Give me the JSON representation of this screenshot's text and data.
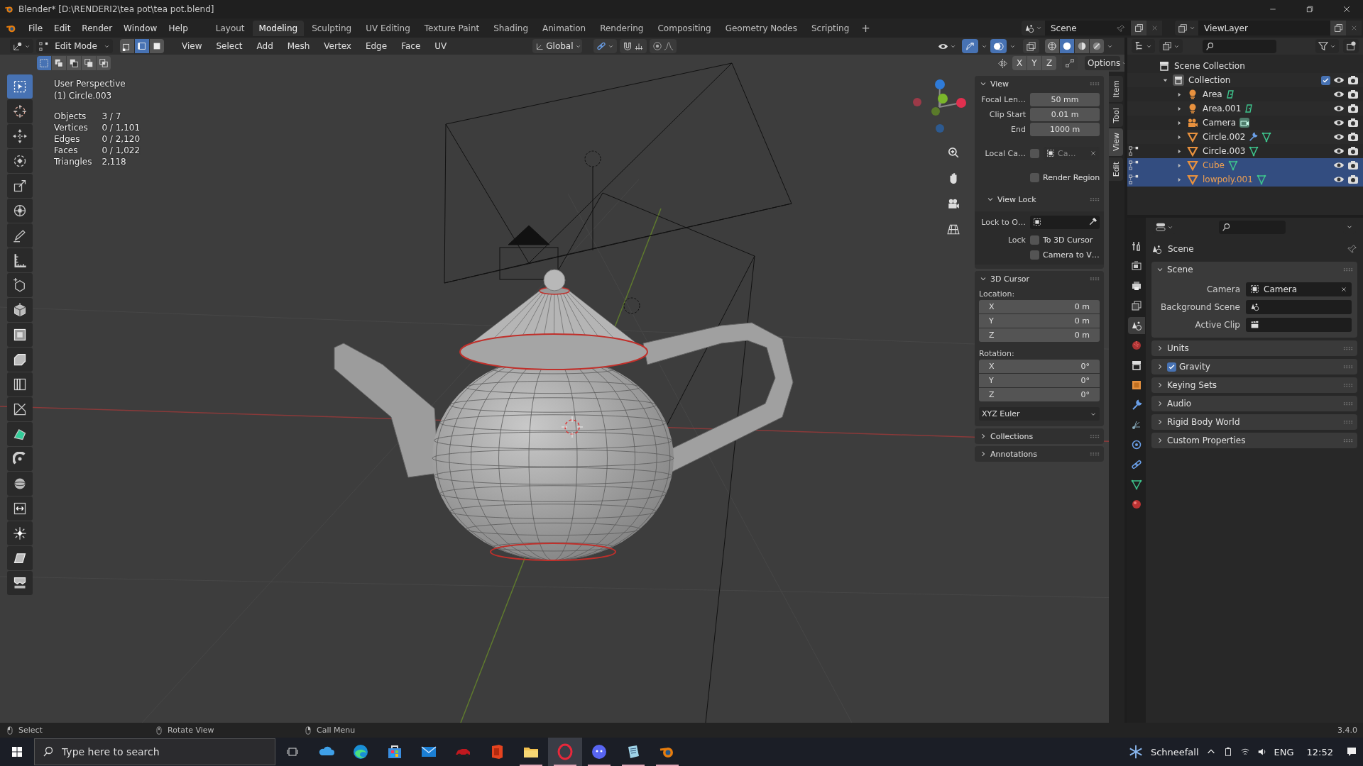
{
  "window": {
    "title": "Blender* [D:\\RENDERI2\\tea pot\\tea pot.blend]"
  },
  "menu": [
    "File",
    "Edit",
    "Render",
    "Window",
    "Help"
  ],
  "workspaces": [
    {
      "label": "Layout",
      "selected": false
    },
    {
      "label": "Modeling",
      "selected": true
    },
    {
      "label": "Sculpting",
      "selected": false
    },
    {
      "label": "UV Editing",
      "selected": false
    },
    {
      "label": "Texture Paint",
      "selected": false
    },
    {
      "label": "Shading",
      "selected": false
    },
    {
      "label": "Animation",
      "selected": false
    },
    {
      "label": "Rendering",
      "selected": false
    },
    {
      "label": "Compositing",
      "selected": false
    },
    {
      "label": "Geometry Nodes",
      "selected": false
    },
    {
      "label": "Scripting",
      "selected": false
    }
  ],
  "add_workspace": "+",
  "scene": {
    "name": "Scene"
  },
  "view_layer": {
    "name": "ViewLayer"
  },
  "viewport": {
    "mode": "Edit Mode",
    "select_modes": [
      {
        "kind": "vertex",
        "selected": false
      },
      {
        "kind": "edge",
        "selected": true
      },
      {
        "kind": "face",
        "selected": false
      }
    ],
    "menus": [
      "View",
      "Select",
      "Add",
      "Mesh",
      "Vertex",
      "Edge",
      "Face",
      "UV"
    ],
    "orientation": "Global",
    "shading": [
      {
        "kind": "wireframe",
        "selected": false
      },
      {
        "kind": "solid",
        "selected": true
      },
      {
        "kind": "material",
        "selected": false
      },
      {
        "kind": "rendered",
        "selected": false
      }
    ],
    "select_ops": [
      {
        "kind": "set",
        "selected": true
      },
      {
        "kind": "extend",
        "selected": false
      },
      {
        "kind": "subtract",
        "selected": false
      },
      {
        "kind": "invert",
        "selected": false
      },
      {
        "kind": "intersect",
        "selected": false
      }
    ],
    "mirror_axes": [
      {
        "label": "X",
        "selected": false
      },
      {
        "label": "Y",
        "selected": false
      },
      {
        "label": "Z",
        "selected": false
      }
    ],
    "options": "Options",
    "info": {
      "view": "User Perspective",
      "object": "(1) Circle.003"
    },
    "stats": [
      {
        "label": "Objects",
        "value": "3 / 7"
      },
      {
        "label": "Vertices",
        "value": "0 / 1,101"
      },
      {
        "label": "Edges",
        "value": "0 / 2,120"
      },
      {
        "label": "Faces",
        "value": "0 / 1,022"
      },
      {
        "label": "Triangles",
        "value": "2,118"
      }
    ],
    "tools": [
      {
        "kind": "select",
        "selected": true
      },
      {
        "kind": "cursor",
        "selected": false
      },
      {
        "kind": "move",
        "selected": false
      },
      {
        "kind": "rotate",
        "selected": false
      },
      {
        "kind": "scale",
        "selected": false
      },
      {
        "kind": "transform",
        "selected": false
      },
      {
        "kind": "annotate",
        "selected": false
      },
      {
        "kind": "measure",
        "selected": false
      },
      {
        "kind": "add-cube",
        "selected": false
      },
      {
        "kind": "extrude",
        "selected": false
      },
      {
        "kind": "inset",
        "selected": false
      },
      {
        "kind": "bevel",
        "selected": false
      },
      {
        "kind": "loop-cut",
        "selected": false
      },
      {
        "kind": "knife",
        "selected": false
      },
      {
        "kind": "poly-build",
        "selected": false
      },
      {
        "kind": "spin",
        "selected": false
      },
      {
        "kind": "smooth",
        "selected": false
      },
      {
        "kind": "slide",
        "selected": false
      },
      {
        "kind": "shrink",
        "selected": false
      },
      {
        "kind": "shear",
        "selected": false
      },
      {
        "kind": "rip",
        "selected": false
      }
    ]
  },
  "sidebar": {
    "tabs": [
      {
        "label": "Item",
        "selected": false
      },
      {
        "label": "Tool",
        "selected": false
      },
      {
        "label": "View",
        "selected": true
      },
      {
        "label": "Edit",
        "selected": false
      }
    ],
    "view": {
      "title": "View",
      "expanded": true,
      "focal_length": {
        "label": "Focal Len…",
        "value": "50 mm"
      },
      "clip_start": {
        "label": "Clip Start",
        "value": "0.01 m"
      },
      "clip_end": {
        "label": "End",
        "value": "1000 m"
      },
      "local_camera": {
        "label": "Local Ca…",
        "checked": false,
        "disabled": true,
        "value": "Ca…"
      },
      "render_region": {
        "label": "Render Region",
        "checked": false
      }
    },
    "view_lock": {
      "title": "View Lock",
      "expanded": true,
      "lock_to_object": {
        "label": "Lock to O…"
      },
      "lock_label": "Lock",
      "to_3d_cursor": {
        "label": "To 3D Cursor",
        "checked": false
      },
      "camera_to_view": {
        "label": "Camera to V…",
        "checked": false
      }
    },
    "cursor": {
      "title": "3D Cursor",
      "expanded": true,
      "location_label": "Location:",
      "location": [
        {
          "axis": "X",
          "value": "0 m"
        },
        {
          "axis": "Y",
          "value": "0 m"
        },
        {
          "axis": "Z",
          "value": "0 m"
        }
      ],
      "rotation_label": "Rotation:",
      "rotation": [
        {
          "axis": "X",
          "value": "0°"
        },
        {
          "axis": "Y",
          "value": "0°"
        },
        {
          "axis": "Z",
          "value": "0°"
        }
      ],
      "rotation_mode": "XYZ Euler"
    },
    "more_panels": [
      {
        "title": "Collections",
        "expanded": false
      },
      {
        "title": "Annotations",
        "expanded": false
      }
    ]
  },
  "outliner": {
    "items": [
      {
        "label": "Scene Collection",
        "kind": "scene-collection",
        "children": [
          {
            "label": "Collection",
            "kind": "collection",
            "expanded": true,
            "checked": true,
            "children": [
              {
                "label": "Area",
                "kind": "light",
                "expanded": false,
                "selected": false,
                "editing": false,
                "modifier": false
              },
              {
                "label": "Area.001",
                "kind": "light",
                "expanded": false,
                "selected": false,
                "editing": false,
                "modifier": false
              },
              {
                "label": "Camera",
                "kind": "camera",
                "expanded": false,
                "selected": false,
                "editing": false,
                "modifier": false
              },
              {
                "label": "Circle.002",
                "kind": "mesh",
                "expanded": false,
                "selected": false,
                "editing": false,
                "modifier": true
              },
              {
                "label": "Circle.003",
                "kind": "mesh",
                "expanded": false,
                "selected": false,
                "editing": true,
                "modifier": false
              },
              {
                "label": "Cube",
                "kind": "mesh",
                "expanded": false,
                "selected": true,
                "editing": true,
                "modifier": false
              },
              {
                "label": "lowpoly.001",
                "kind": "mesh",
                "expanded": false,
                "selected": true,
                "editing": true,
                "modifier": false
              }
            ]
          }
        ]
      }
    ]
  },
  "properties": {
    "tabs": [
      {
        "kind": "tool",
        "selected": false
      },
      {
        "kind": "render",
        "selected": false
      },
      {
        "kind": "output",
        "selected": false
      },
      {
        "kind": "view-layer",
        "selected": false
      },
      {
        "kind": "scene",
        "selected": true
      },
      {
        "kind": "world",
        "selected": false
      },
      {
        "kind": "collection",
        "selected": false
      },
      {
        "kind": "object",
        "selected": false
      },
      {
        "kind": "modifiers",
        "selected": false
      },
      {
        "kind": "particles",
        "selected": false
      },
      {
        "kind": "physics",
        "selected": false
      },
      {
        "kind": "constraints",
        "selected": false
      },
      {
        "kind": "data",
        "selected": false
      },
      {
        "kind": "material",
        "selected": false
      }
    ],
    "context": "Scene",
    "scene_panel": {
      "title": "Scene",
      "expanded": true,
      "fields": [
        {
          "label": "Camera",
          "kind": "camera",
          "value": "Camera"
        },
        {
          "label": "Background Scene",
          "kind": "scene"
        },
        {
          "label": "Active Clip",
          "kind": "clip"
        }
      ]
    },
    "panels": [
      {
        "title": "Units",
        "kind": "plain",
        "expanded": false
      },
      {
        "title": "Gravity",
        "kind": "toggle",
        "checked": true,
        "expanded": false
      },
      {
        "title": "Keying Sets",
        "kind": "plain",
        "expanded": false
      },
      {
        "title": "Audio",
        "kind": "plain",
        "expanded": false
      },
      {
        "title": "Rigid Body World",
        "kind": "plain",
        "expanded": false
      },
      {
        "title": "Custom Properties",
        "kind": "plain",
        "expanded": false
      }
    ]
  },
  "status": {
    "hints": [
      {
        "kind": "left-click",
        "label": "Select"
      },
      {
        "kind": "middle-click",
        "label": "Rotate View"
      },
      {
        "kind": "right-click",
        "label": "Call Menu"
      }
    ],
    "version": "3.4.0"
  },
  "taskbar": {
    "search_placeholder": "Type here to search",
    "apps": [
      {
        "kind": "cloud",
        "selected": false,
        "running": false
      },
      {
        "kind": "browser",
        "selected": false,
        "running": false
      },
      {
        "kind": "store",
        "selected": false,
        "running": false
      },
      {
        "kind": "mail",
        "selected": false,
        "running": false
      },
      {
        "kind": "game",
        "selected": false,
        "running": false
      },
      {
        "kind": "office",
        "selected": false,
        "running": false
      },
      {
        "kind": "folder",
        "selected": false,
        "running": true
      },
      {
        "kind": "ring",
        "selected": true,
        "running": true
      },
      {
        "kind": "chat",
        "selected": false,
        "running": true
      },
      {
        "kind": "notes",
        "selected": false,
        "running": true
      },
      {
        "kind": "orbit",
        "selected": false,
        "running": true
      }
    ],
    "weather": "Schneefall",
    "language": "ENG",
    "time": "12:52"
  }
}
